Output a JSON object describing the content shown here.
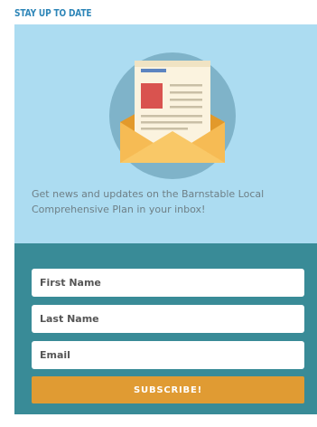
{
  "widget": {
    "heading": "STAY UP TO DATE",
    "description": "Get news and updates on the Barnstable Local Comprehensive Plan in your inbox!",
    "illustration_icon": "newsletter-envelope-icon"
  },
  "form": {
    "first_name_placeholder": "First Name",
    "last_name_placeholder": "Last Name",
    "email_placeholder": "Email",
    "subscribe_label": "SUBSCRIBE!"
  },
  "colors": {
    "heading": "#2e86b8",
    "top_panel": "#acdcf1",
    "form_panel": "#398b97",
    "button": "#e09b33",
    "text": "#6e7f86"
  }
}
